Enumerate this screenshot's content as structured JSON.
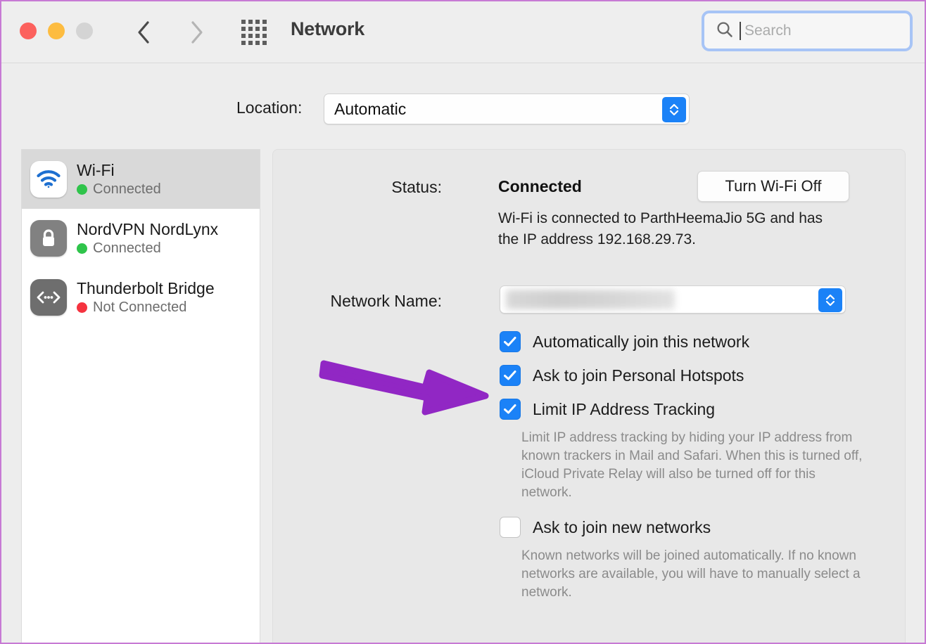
{
  "window": {
    "title": "Network",
    "accent_blue": "#1b82f7",
    "annotation_color": "#9127c4",
    "border_color": "#c77ad4"
  },
  "titlebar": {
    "traffic_lights": [
      {
        "name": "close",
        "color": "#fc615d"
      },
      {
        "name": "minimize",
        "color": "#fdbc40"
      },
      {
        "name": "maximize",
        "color": "#d4d4d4"
      }
    ],
    "back_icon": "chevron-left",
    "forward_icon": "chevron-right",
    "grid_icon": "show-all-grid",
    "title": "Network"
  },
  "search": {
    "icon": "search-icon",
    "placeholder": "Search",
    "value": "",
    "focused": true
  },
  "location": {
    "label": "Location:",
    "value": "Automatic",
    "options": [
      "Automatic"
    ]
  },
  "sidebar": {
    "items": [
      {
        "name": "Wi-Fi",
        "status": "Connected",
        "status_color": "#2fc44b",
        "icon": "wifi-icon",
        "selected": true
      },
      {
        "name": "NordVPN NordLynx",
        "status": "Connected",
        "status_color": "#2fc44b",
        "icon": "lock-icon",
        "selected": false
      },
      {
        "name": "Thunderbolt Bridge",
        "status": "Not Connected",
        "status_color": "#f5333f",
        "icon": "thunderbolt-bridge-icon",
        "selected": false
      }
    ]
  },
  "main": {
    "status_label": "Status:",
    "status_value": "Connected",
    "toggle_button": "Turn Wi-Fi Off",
    "status_description": "Wi-Fi is connected to ParthHeemaJio 5G and has the IP address 192.168.29.73.",
    "network_name_label": "Network Name:",
    "network_name_value": "",
    "checkboxes": [
      {
        "label": "Automatically join this network",
        "checked": true,
        "help": ""
      },
      {
        "label": "Ask to join Personal Hotspots",
        "checked": true,
        "help": ""
      },
      {
        "label": "Limit IP Address Tracking",
        "checked": true,
        "help": "Limit IP address tracking by hiding your IP address from known trackers in Mail and Safari. When this is turned off, iCloud Private Relay will also be turned off for this network."
      },
      {
        "label": "Ask to join new networks",
        "checked": false,
        "help": "Known networks will be joined automatically. If no known networks are available, you will have to manually select a network."
      }
    ]
  },
  "annotation": {
    "type": "arrow",
    "color": "#9127c4",
    "points_to": "Limit IP Address Tracking"
  }
}
